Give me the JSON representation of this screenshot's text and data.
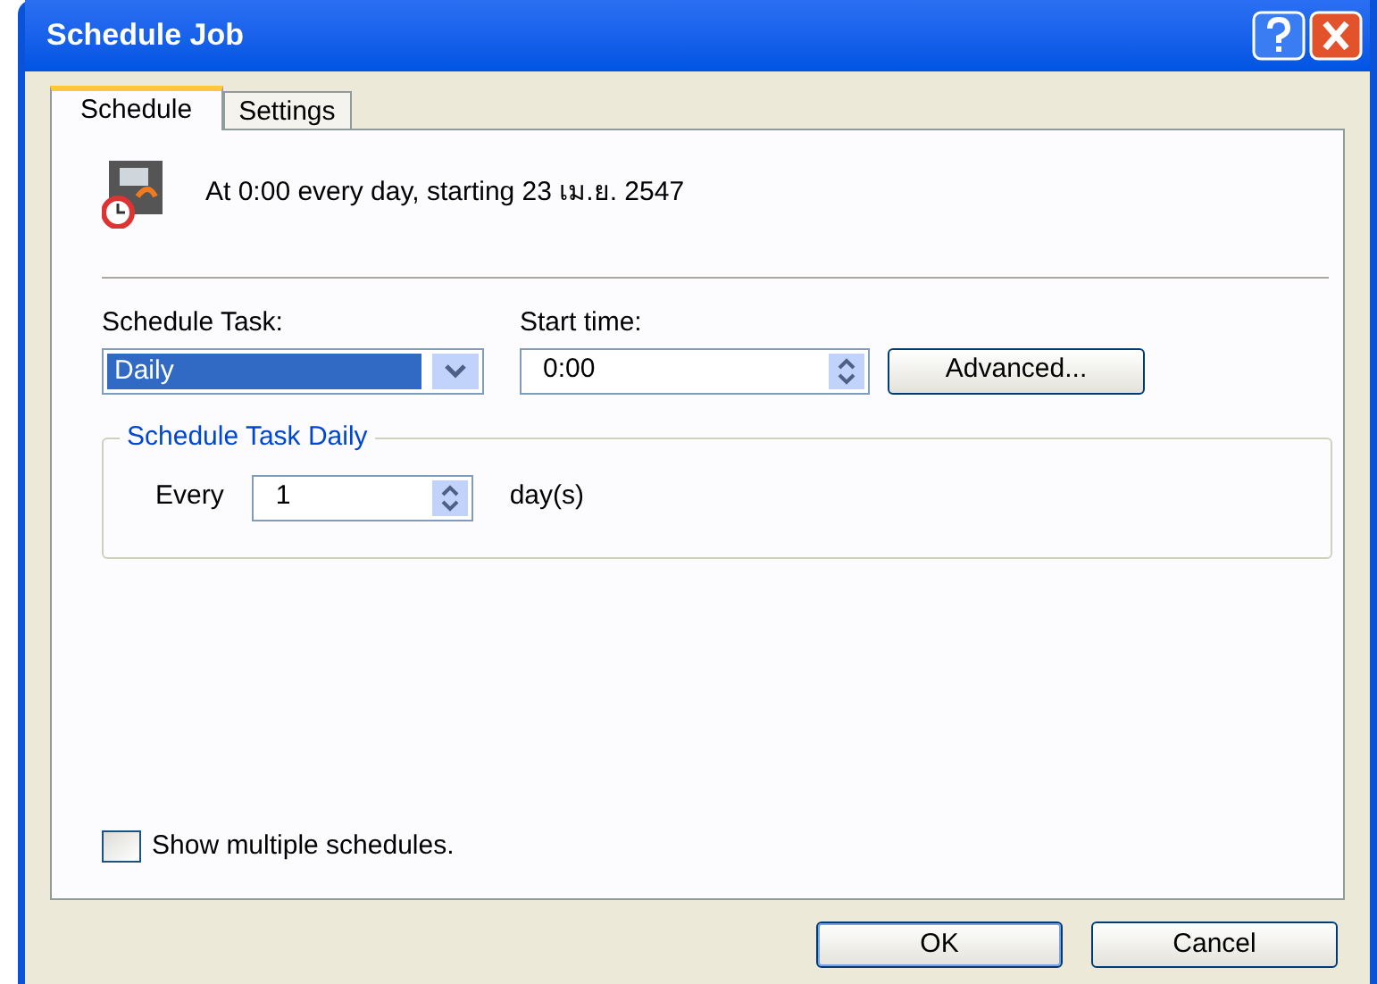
{
  "window": {
    "title": "Schedule Job"
  },
  "tabs": [
    {
      "label": "Schedule",
      "selected": true
    },
    {
      "label": "Settings",
      "selected": false
    }
  ],
  "summary": "At 0:00 every day, starting 23 เม.ย. 2547",
  "schedule_task": {
    "label": "Schedule Task:",
    "value": "Daily"
  },
  "start_time": {
    "label": "Start time:",
    "value": "0:00"
  },
  "advanced_button": "Advanced...",
  "group": {
    "title": "Schedule Task Daily",
    "every_label": "Every",
    "every_value": "1",
    "unit": "day(s)"
  },
  "show_multiple": {
    "label": "Show multiple schedules.",
    "checked": false
  },
  "buttons": [
    "OK",
    "Cancel"
  ]
}
